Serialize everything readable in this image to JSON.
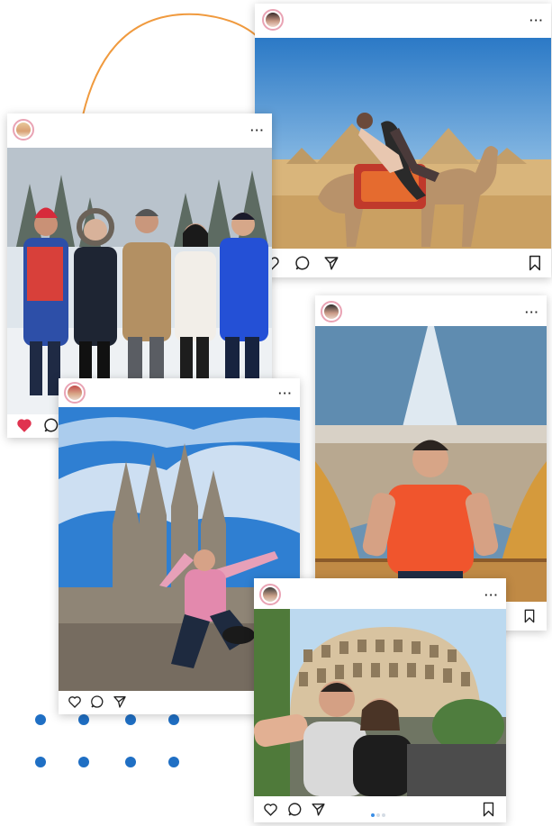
{
  "colors": {
    "arc": "#f09a3e",
    "dots": "#1f6fc4",
    "heart_liked": "#e0334f",
    "icon_stroke": "#222222"
  },
  "posts": [
    {
      "id": "pyramids",
      "scene": "woman riding a camel in front of the pyramids of Giza",
      "more_icon": "more-dots-icon",
      "actions": [
        "heart-icon",
        "comment-icon",
        "share-icon",
        "bookmark-icon"
      ]
    },
    {
      "id": "snow",
      "scene": "five friends posing in snowy forest",
      "more_icon": "more-dots-icon",
      "liked": true,
      "actions": [
        "heart-icon",
        "comment-icon"
      ]
    },
    {
      "id": "cruise",
      "scene": "man in orange shirt on a cruise ship deck",
      "more_icon": "more-dots-icon",
      "actions": [
        "bookmark-icon"
      ]
    },
    {
      "id": "barcelona",
      "scene": "woman jumping in front of Sagrada Familia",
      "more_icon": "more-dots-icon",
      "actions": [
        "heart-icon",
        "comment-icon",
        "share-icon"
      ]
    },
    {
      "id": "colosseum",
      "scene": "couple taking a selfie in front of the Colosseum",
      "more_icon": "more-dots-icon",
      "carousel_pages": 3,
      "carousel_active": 1,
      "actions": [
        "heart-icon",
        "comment-icon",
        "share-icon",
        "bookmark-icon"
      ]
    }
  ]
}
